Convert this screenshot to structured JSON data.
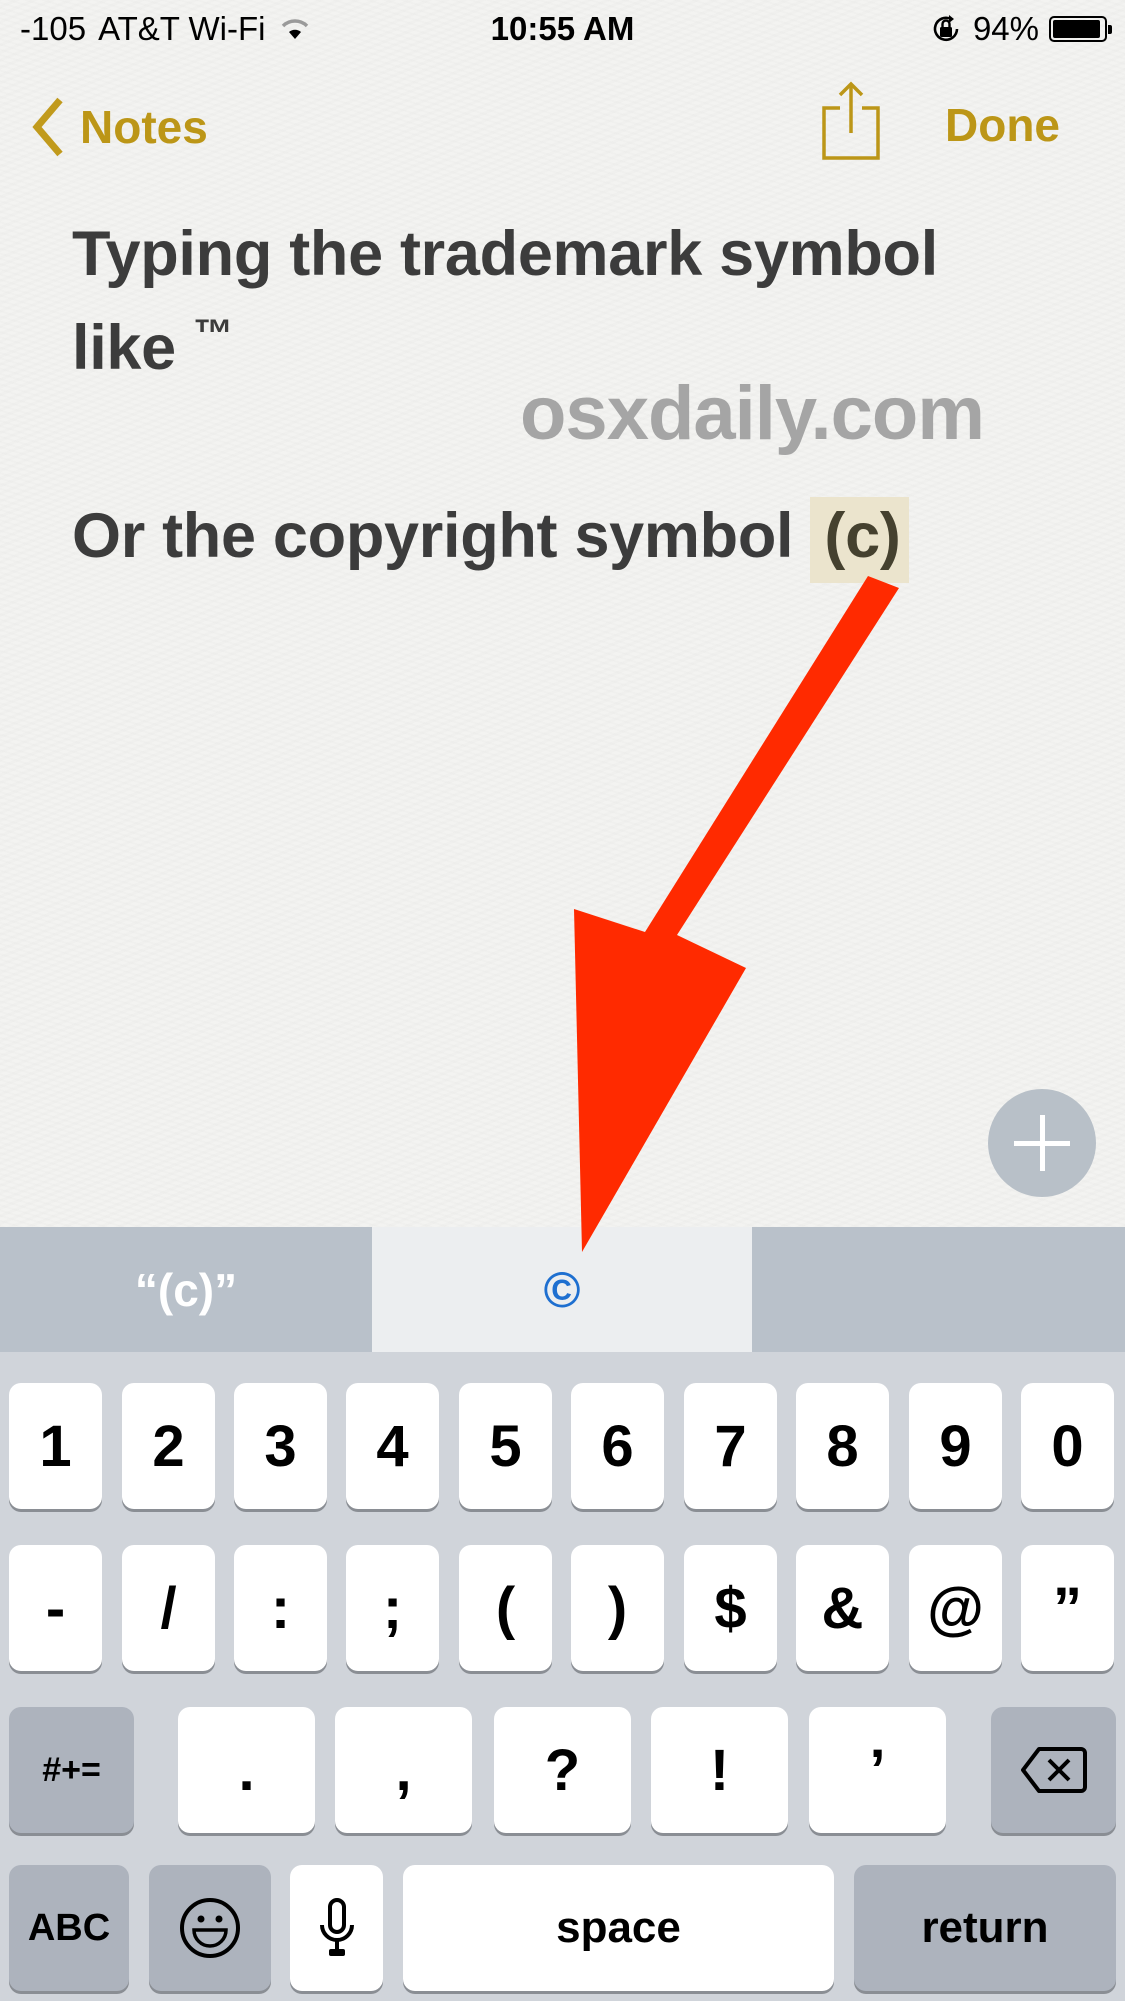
{
  "status_bar": {
    "signal": "-105",
    "carrier": "AT&T Wi-Fi",
    "wifi_icon": "wifi-icon",
    "time": "10:55 AM",
    "rotation_lock_icon": "rotation-lock-icon",
    "battery_percent": "94%",
    "battery_level": 0.94
  },
  "nav": {
    "back_label": "Notes",
    "back_icon": "chevron-left-icon",
    "share_icon": "share-icon",
    "done_label": "Done"
  },
  "note": {
    "line1": "Typing the trademark symbol",
    "line2_text": "like ",
    "line2_symbol": "™",
    "line3_text": "Or the copyright symbol ",
    "line3_highlight": "(c)"
  },
  "watermark": "osxdaily.com",
  "plus_button": {
    "icon": "plus-icon"
  },
  "suggestions": [
    {
      "label": "“(c)”"
    },
    {
      "label": "©"
    },
    {
      "label": ""
    }
  ],
  "keyboard": {
    "row1": [
      "1",
      "2",
      "3",
      "4",
      "5",
      "6",
      "7",
      "8",
      "9",
      "0"
    ],
    "row2": [
      "-",
      "/",
      ":",
      ";",
      "(",
      ")",
      "$",
      "&",
      "@",
      "”"
    ],
    "row3": {
      "mode_key": "#+=",
      "keys": [
        ".",
        ",",
        "?",
        "!",
        "’"
      ],
      "delete_icon": "backspace-icon"
    },
    "row4": {
      "abc_key": "ABC",
      "emoji_icon": "emoji-icon",
      "mic_icon": "microphone-icon",
      "space_key": "space",
      "return_key": "return"
    }
  },
  "annotation": {
    "arrow_color": "#ff2a00",
    "description": "red arrow pointing from (c) to © suggestion"
  },
  "colors": {
    "accent": "#bc9617",
    "suggestion_blue": "#1e6fd0"
  }
}
